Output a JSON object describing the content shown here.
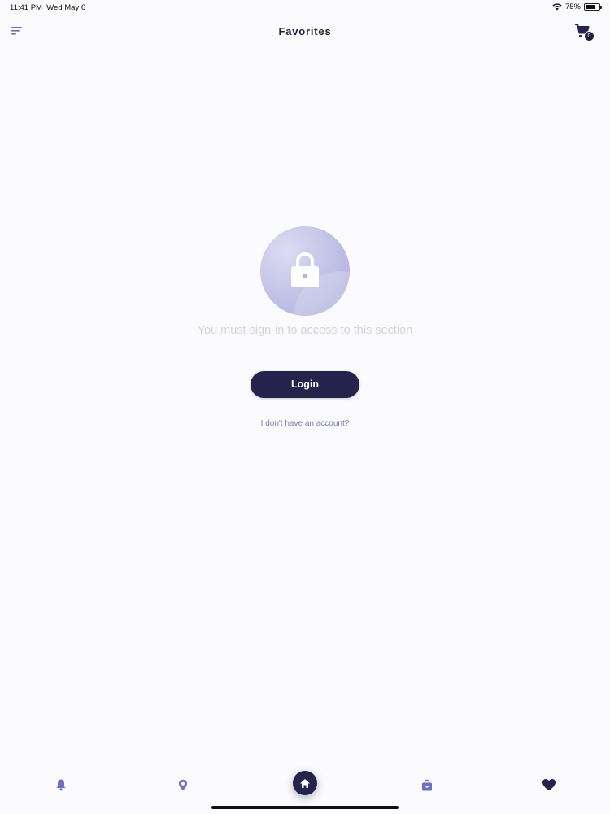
{
  "status_bar": {
    "time": "11:41 PM",
    "date": "Wed May 6",
    "battery": "75%",
    "battery_level": 0.75
  },
  "header": {
    "title": "Favorites",
    "cart_count": "0"
  },
  "empty_state": {
    "message": "You must sign-in to access to this section",
    "login_label": "Login",
    "register_link": "I don't have an account?"
  },
  "tab_bar": {
    "items": [
      {
        "icon": "bell-icon"
      },
      {
        "icon": "location-pin-icon"
      },
      {
        "icon": "home-icon"
      },
      {
        "icon": "shopping-bag-icon"
      },
      {
        "icon": "heart-icon"
      }
    ]
  },
  "colors": {
    "background": "#fbfbfd",
    "primary": "#23234b",
    "accent": "#7a7aae",
    "muted_text": "#d3d3dc",
    "lock_circle": "#c2c2e6"
  }
}
